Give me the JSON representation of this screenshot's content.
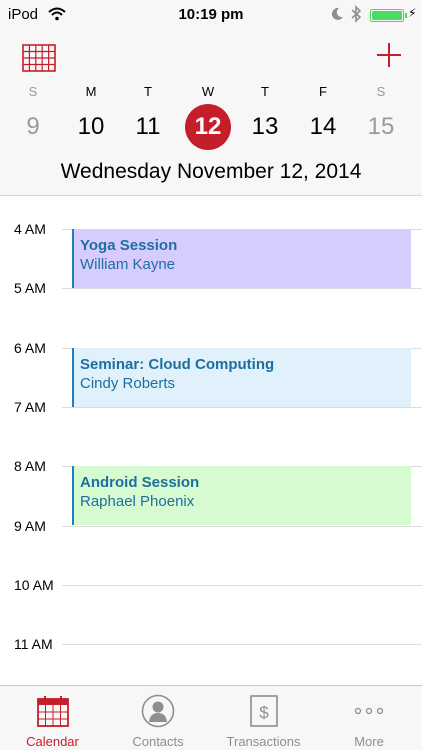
{
  "status_bar": {
    "carrier": "iPod",
    "time": "10:19 pm",
    "wifi_icon": "wifi-icon",
    "moon_icon": "moon-icon",
    "bluetooth_icon": "bluetooth-icon",
    "battery_level": 1.0,
    "charging_icon": "bolt-icon"
  },
  "header": {
    "calendar_grid_icon": "calendar-grid-icon",
    "add_icon": "plus-icon",
    "accent_color": "#c41e2b",
    "week": [
      {
        "dow": "S",
        "num": "9",
        "weekend": true
      },
      {
        "dow": "M",
        "num": "10",
        "weekend": false
      },
      {
        "dow": "T",
        "num": "11",
        "weekend": false
      },
      {
        "dow": "W",
        "num": "12",
        "weekend": false,
        "selected": true
      },
      {
        "dow": "T",
        "num": "13",
        "weekend": false
      },
      {
        "dow": "F",
        "num": "14",
        "weekend": false
      },
      {
        "dow": "S",
        "num": "15",
        "weekend": true
      }
    ],
    "date_title": "Wednesday November 12, 2014"
  },
  "schedule": {
    "hours": [
      "4 AM",
      "5 AM",
      "6 AM",
      "7 AM",
      "8 AM",
      "9 AM",
      "10 AM",
      "11 AM"
    ],
    "events": [
      {
        "title": "Yoga Session",
        "person": "William Kayne",
        "start": "4 AM",
        "end": "5 AM",
        "color": "#d7ccff"
      },
      {
        "title": "Seminar: Cloud Computing",
        "person": "Cindy Roberts",
        "start": "6 AM",
        "end": "7 AM",
        "color": "#e0f1fb"
      },
      {
        "title": "Android Session",
        "person": "Raphael Phoenix",
        "start": "8 AM",
        "end": "9 AM",
        "color": "#d6fbd0"
      }
    ]
  },
  "tab_bar": {
    "tabs": [
      {
        "label": "Calendar",
        "icon": "calendar-icon",
        "active": true
      },
      {
        "label": "Contacts",
        "icon": "contact-icon",
        "active": false
      },
      {
        "label": "Transactions",
        "icon": "dollar-icon",
        "active": false
      },
      {
        "label": "More",
        "icon": "more-dots-icon",
        "active": false
      }
    ]
  }
}
